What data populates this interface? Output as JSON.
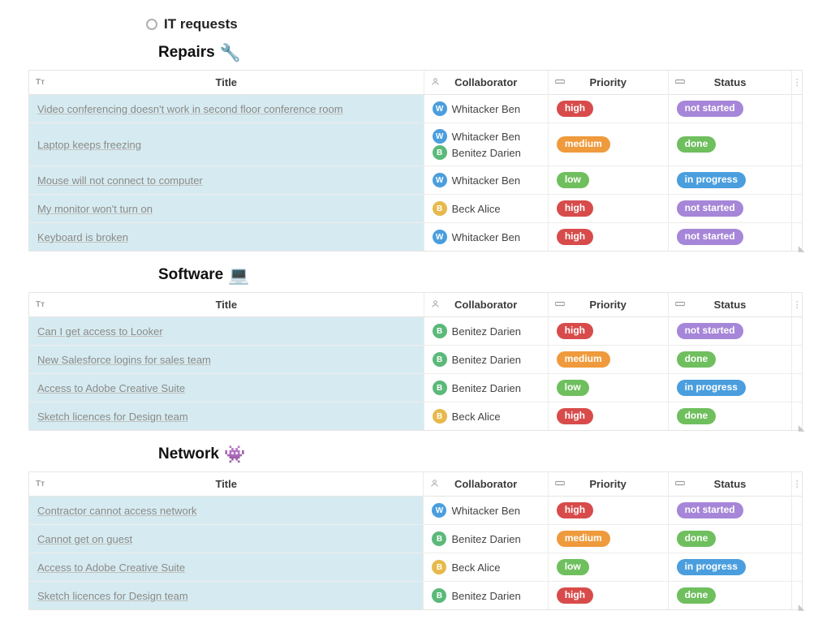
{
  "page": {
    "title": "IT requests"
  },
  "columns": {
    "title": "Title",
    "collaborator": "Collaborator",
    "priority": "Priority",
    "status": "Status"
  },
  "collaborators": {
    "whitacker": {
      "name": "Whitacker Ben",
      "initial": "W",
      "color": "blue"
    },
    "benitez": {
      "name": "Benitez Darien",
      "initial": "B",
      "color": "green"
    },
    "beck": {
      "name": "Beck Alice",
      "initial": "B",
      "color": "yellow"
    }
  },
  "priority_labels": {
    "high": "high",
    "medium": "medium",
    "low": "low"
  },
  "status_labels": {
    "notstarted": "not started",
    "done": "done",
    "inprogress": "in progress"
  },
  "sections": [
    {
      "title": "Repairs",
      "emoji": "🔧",
      "rows": [
        {
          "title": "Video conferencing doesn't work in second floor conference room",
          "collab": [
            "whitacker"
          ],
          "priority": "high",
          "status": "notstarted"
        },
        {
          "title": "Laptop keeps freezing",
          "collab": [
            "whitacker",
            "benitez"
          ],
          "priority": "medium",
          "status": "done"
        },
        {
          "title": "Mouse will not connect to computer",
          "collab": [
            "whitacker"
          ],
          "priority": "low",
          "status": "inprogress"
        },
        {
          "title": "My monitor won't turn on",
          "collab": [
            "beck"
          ],
          "priority": "high",
          "status": "notstarted"
        },
        {
          "title": "Keyboard is broken",
          "collab": [
            "whitacker"
          ],
          "priority": "high",
          "status": "notstarted"
        }
      ]
    },
    {
      "title": "Software",
      "emoji": "💻",
      "rows": [
        {
          "title": "Can I get access to Looker",
          "collab": [
            "benitez"
          ],
          "priority": "high",
          "status": "notstarted"
        },
        {
          "title": "New Salesforce logins for sales team",
          "collab": [
            "benitez"
          ],
          "priority": "medium",
          "status": "done"
        },
        {
          "title": "Access to Adobe Creative Suite",
          "collab": [
            "benitez"
          ],
          "priority": "low",
          "status": "inprogress"
        },
        {
          "title": "Sketch licences for Design team",
          "collab": [
            "beck"
          ],
          "priority": "high",
          "status": "done"
        }
      ]
    },
    {
      "title": "Network",
      "emoji": "👾",
      "rows": [
        {
          "title": "Contractor cannot access network",
          "collab": [
            "whitacker"
          ],
          "priority": "high",
          "status": "notstarted"
        },
        {
          "title": "Cannot get on guest",
          "collab": [
            "benitez"
          ],
          "priority": "medium",
          "status": "done"
        },
        {
          "title": "Access to Adobe Creative Suite",
          "collab": [
            "beck"
          ],
          "priority": "low",
          "status": "inprogress"
        },
        {
          "title": "Sketch licences for Design team",
          "collab": [
            "benitez"
          ],
          "priority": "high",
          "status": "done"
        }
      ]
    }
  ]
}
